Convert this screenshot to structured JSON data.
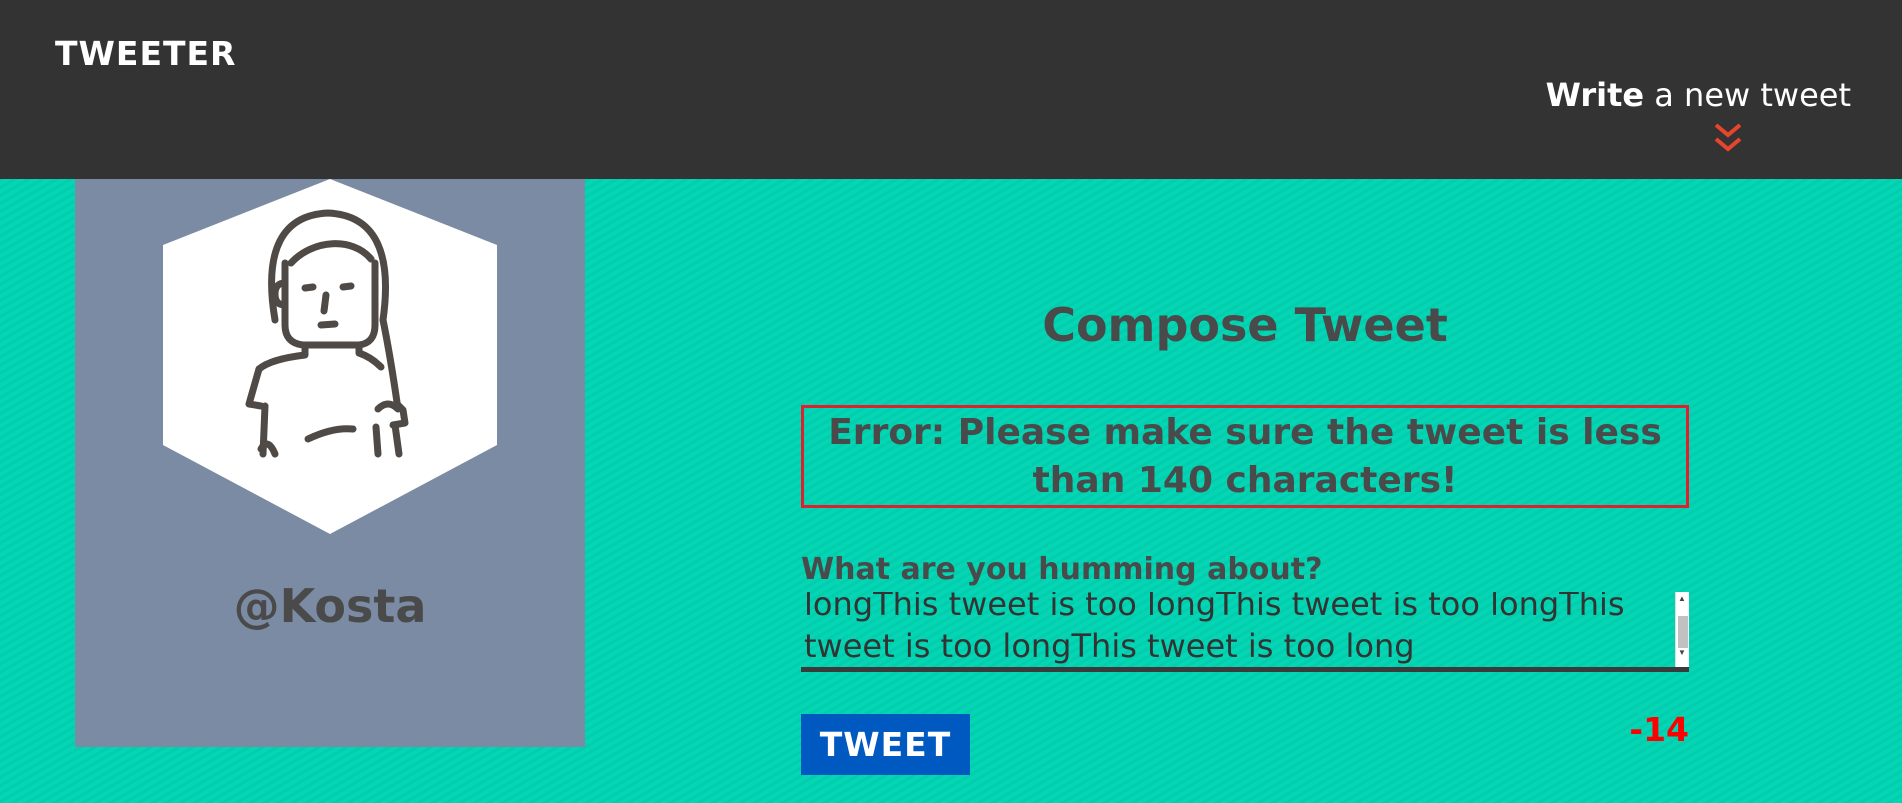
{
  "nav": {
    "brand": "TWEETER",
    "compose_bold": "Write",
    "compose_rest": " a new tweet",
    "chevron_icon": "double-chevron-down-icon",
    "chevron_color": "#e8452c"
  },
  "profile": {
    "avatar_icon": "user-avatar-icon",
    "handle": "@Kosta",
    "panel_color": "#7a8ba3"
  },
  "compose": {
    "title": "Compose Tweet",
    "error": "Error: Please make sure the tweet is less than 140 characters!",
    "label": "What are you humming about?",
    "text": "longThis tweet is too longThis tweet is too longThis tweet is too longThis tweet is too long",
    "button": "TWEET",
    "counter": "-14",
    "counter_color": "#ff0000",
    "button_color": "#0059c1"
  },
  "colors": {
    "background": "#00d4b2",
    "nav": "#333333",
    "error_border": "#e0202c"
  }
}
